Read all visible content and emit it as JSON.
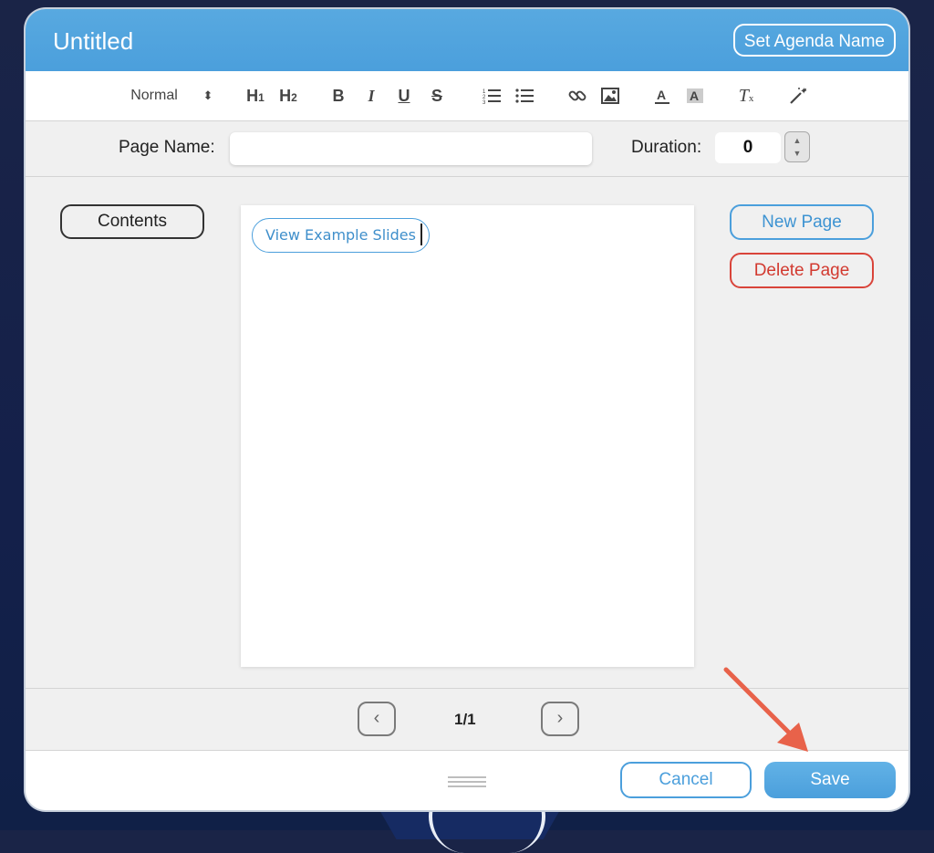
{
  "window": {
    "title": "Untitled",
    "set_name_label": "Set Agenda Name"
  },
  "toolbar": {
    "format_select": "Normal",
    "items": [
      "H1",
      "H2",
      "B",
      "I",
      "U",
      "S",
      "ordered-list",
      "bullet-list",
      "link",
      "image",
      "text-color",
      "highlight",
      "clear-format",
      "magic-wand"
    ]
  },
  "fields": {
    "page_name_label": "Page Name:",
    "page_name_value": "",
    "duration_label": "Duration:",
    "duration_value": "0"
  },
  "sidebar": {
    "contents_label": "Contents"
  },
  "canvas": {
    "example_label": "View Example Slides"
  },
  "actions": {
    "new_page_label": "New Page",
    "delete_page_label": "Delete Page"
  },
  "pager": {
    "page_indicator": "1/1",
    "prev_glyph": "‹",
    "next_glyph": "›"
  },
  "footer": {
    "cancel_label": "Cancel",
    "save_label": "Save"
  },
  "colors": {
    "accent": "#4b9fdc",
    "danger": "#d9443a",
    "annotation_arrow": "#e8624a"
  }
}
